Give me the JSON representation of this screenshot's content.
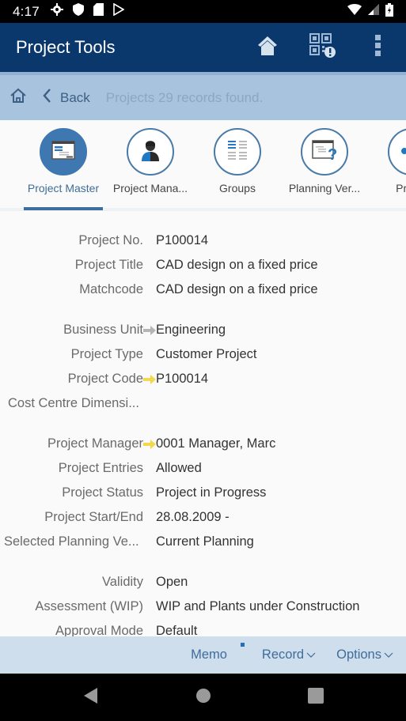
{
  "status_bar": {
    "time": "4:17",
    "left_icons": [
      "gear-icon",
      "shield-icon",
      "sd-card-icon",
      "play-store-icon"
    ],
    "right_icons": [
      "wifi-icon",
      "cellular-icon",
      "battery-charging-icon"
    ]
  },
  "app_bar": {
    "title": "Project Tools",
    "actions": [
      "home-icon",
      "qr-code-icon",
      "overflow-menu-icon"
    ]
  },
  "nav": {
    "back_label": "Back",
    "info": "Projects 29 records found."
  },
  "tabs": [
    {
      "label": "Project Master",
      "icon": "form-icon",
      "active": true
    },
    {
      "label": "Project Mana...",
      "icon": "person-icon",
      "active": false
    },
    {
      "label": "Groups",
      "icon": "groups-list-icon",
      "active": false
    },
    {
      "label": "Planning Ver...",
      "icon": "planning-help-icon",
      "active": false
    },
    {
      "label": "Projec",
      "icon": "project-link-icon",
      "active": false
    }
  ],
  "fields": [
    {
      "label": "Project No.",
      "value": "P100014",
      "arrow": ""
    },
    {
      "label": "Project Title",
      "value": "CAD design on a fixed price",
      "arrow": ""
    },
    {
      "label": "Matchcode",
      "value": "CAD design on a fixed price",
      "arrow": ""
    },
    {
      "label": "Business Unit",
      "value": "Engineering",
      "arrow": "gray"
    },
    {
      "label": "Project Type",
      "value": "Customer Project",
      "arrow": ""
    },
    {
      "label": "Project Code",
      "value": "P100014",
      "arrow": "yellow"
    },
    {
      "label": "Cost Centre Dimensi...",
      "value": "",
      "arrow": ""
    },
    {
      "label": "Project Manager",
      "value": "0001 Manager, Marc",
      "arrow": "yellow"
    },
    {
      "label": "Project Entries",
      "value": "Allowed",
      "arrow": ""
    },
    {
      "label": "Project Status",
      "value": "Project in Progress",
      "arrow": ""
    },
    {
      "label": "Project Start/End",
      "value": "28.08.2009 -",
      "arrow": ""
    },
    {
      "label": "Selected Planning Ve...",
      "value": "Current Planning",
      "arrow": ""
    },
    {
      "label": "Validity",
      "value": "Open",
      "arrow": ""
    },
    {
      "label": "Assessment (WIP)",
      "value": "WIP and Plants under Construction",
      "arrow": ""
    },
    {
      "label": "Approval Mode",
      "value": "Default",
      "arrow": ""
    }
  ],
  "bottom_bar": {
    "memo": "Memo",
    "record": "Record",
    "options": "Options"
  },
  "colors": {
    "app_bar": "#0a386c",
    "nav_bar": "#a8c3de",
    "accent": "#3f78b0",
    "arrow_yellow": "#f2d84a",
    "arrow_gray": "#b5b5b5"
  }
}
